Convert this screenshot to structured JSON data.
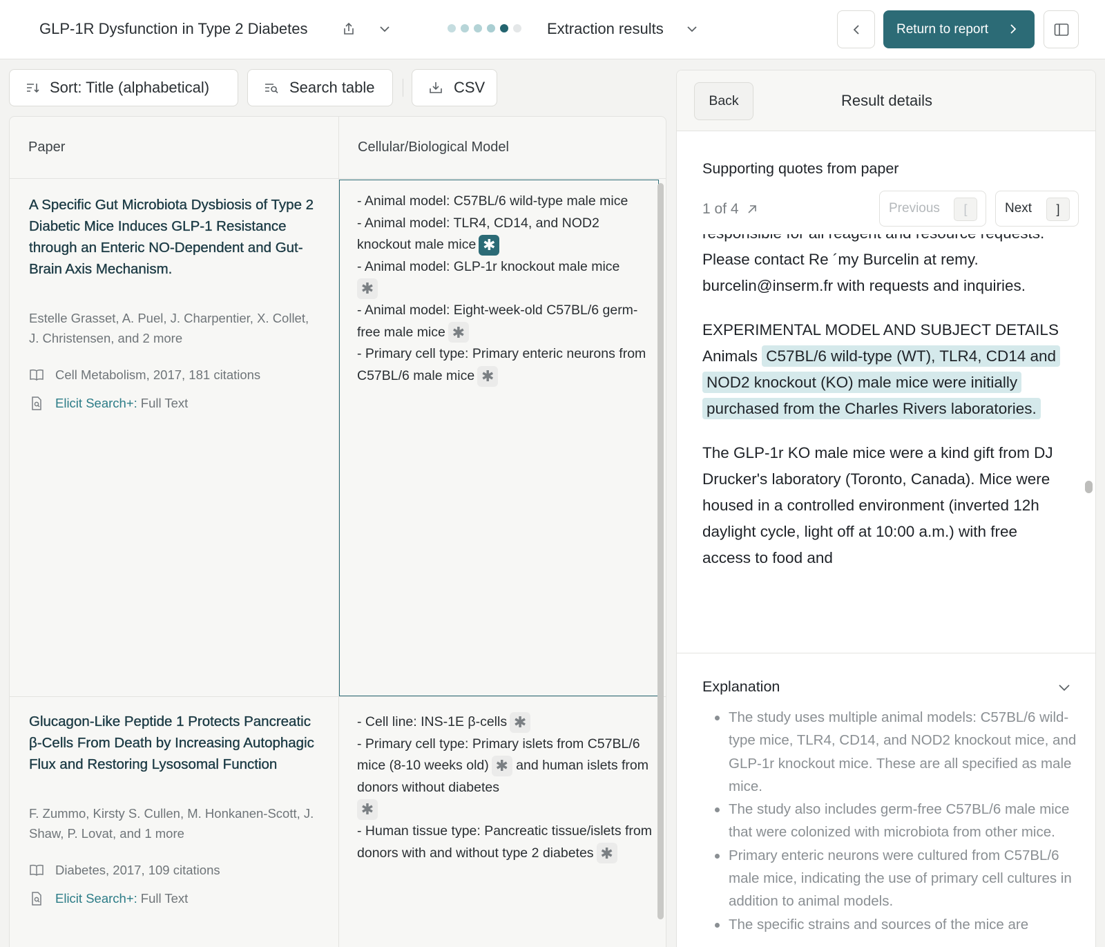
{
  "header": {
    "project_title": "GLP-1R Dysfunction in Type 2 Diabetes",
    "step_label": "Extraction results",
    "return_label": "Return to report",
    "progress_steps": 6,
    "progress_current": 5
  },
  "toolbar": {
    "sort_label": "Sort: Title (alphabetical)",
    "search_label": "Search table",
    "csv_label": "CSV"
  },
  "table": {
    "columns": [
      "Paper",
      "Cellular/Biological Model"
    ],
    "rows": [
      {
        "title": "A Specific Gut Microbiota Dysbiosis of Type 2 Diabetic Mice Induces GLP-1 Resistance through an Enteric NO-Dependent and Gut-Brain Axis Mechanism.",
        "authors": "Estelle Grasset, A. Puel, J. Charpentier, X. Collet, J. Christensen, and 2 more",
        "venue": "Cell Metabolism, 2017, 181 citations",
        "link_label": "Elicit Search+:",
        "link_suffix": "Full Text",
        "model_lines": [
          "- Animal model: C57BL/6 wild-type male mice",
          "- Animal model: TLR4, CD14, and NOD2 knockout male mice",
          "- Animal model: GLP-1r knockout male mice",
          "- Animal model: Eight-week-old C57BL/6 germ-free male mice",
          "- Primary cell type: Primary enteric neurons from C57BL/6 male mice"
        ]
      },
      {
        "title": "Glucagon-Like Peptide 1 Protects Pancreatic β-Cells From Death by Increasing Autophagic Flux and Restoring Lysosomal Function",
        "authors": "F. Zummo, Kirsty S. Cullen, M. Honkanen-Scott, J. Shaw, P. Lovat, and 1 more",
        "venue": "Diabetes, 2017, 109 citations",
        "link_label": "Elicit Search+:",
        "link_suffix": "Full Text",
        "model_lines": [
          "- Cell line: INS-1E β-cells",
          "- Primary cell type: Primary islets from C57BL/6 mice (8-10 weeks old)",
          "and human islets from donors without diabetes",
          "- Human tissue type: Pancreatic tissue/islets from donors with and without type 2 diabetes"
        ]
      }
    ]
  },
  "details": {
    "back_label": "Back",
    "title": "Result details",
    "quotes_heading": "Supporting quotes from paper",
    "pager_text": "1 of 4",
    "previous_label": "Previous",
    "previous_key": "[",
    "next_label": "Next",
    "next_key": "]",
    "quote_paragraphs": [
      "responsible for all reagent and resource requests. Please contact Re ´my Burcelin at remy. burcelin@inserm.fr with requests and inquiries.",
      "The GLP-1r KO male mice were a kind gift from DJ Drucker's laboratory (Toronto, Canada). Mice were housed in a controlled environment (inverted 12h daylight cycle, light off at 10:00 a.m.) with free access to food and"
    ],
    "quote_mid_prefix": "EXPERIMENTAL MODEL AND SUBJECT DETAILS Animals",
    "quote_highlight": "C57BL/6 wild-type (WT), TLR4, CD14 and NOD2 knockout (KO) male mice were initially purchased from the Charles Rivers laboratories.",
    "explanation_heading": "Explanation",
    "explanation_items": [
      "The study uses multiple animal models: C57BL/6 wild-type mice, TLR4, CD14, and NOD2 knockout mice, and GLP-1r knockout mice. These are all specified as male mice.",
      "The study also includes germ-free C57BL/6 male mice that were colonized with microbiota from other mice.",
      "Primary enteric neurons were cultured from C57BL/6 male mice, indicating the use of primary cell cultures in addition to animal models.",
      "The specific strains and sources of the mice are"
    ]
  },
  "colors": {
    "accent": "#2c6b76",
    "highlight": "#d5e9eb",
    "link": "#2c7c87"
  }
}
